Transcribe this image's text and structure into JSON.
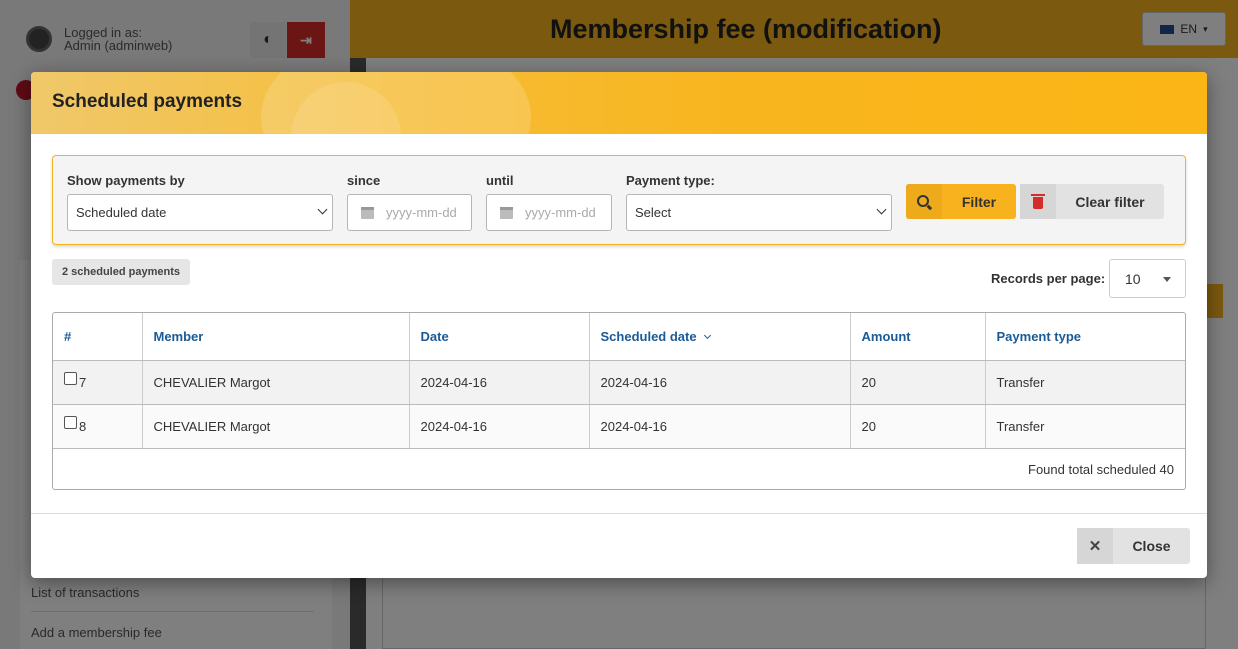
{
  "background": {
    "user": {
      "logged_in_label": "Logged in as:",
      "user_name": "Admin (adminweb)"
    },
    "page_title": "Membership fee (modification)",
    "language": "EN",
    "menu": [
      "List of transactions",
      "Add a membership fee"
    ]
  },
  "modal": {
    "title": "Scheduled payments",
    "filter": {
      "show_by_label": "Show payments by",
      "show_by_value": "Scheduled date",
      "since_label": "since",
      "since_placeholder": "yyyy-mm-dd",
      "until_label": "until",
      "until_placeholder": "yyyy-mm-dd",
      "payment_type_label": "Payment type:",
      "payment_type_value": "Select",
      "filter_button": "Filter",
      "clear_button": "Clear filter"
    },
    "count_badge": "2 scheduled payments",
    "records_per_page_label": "Records per page:",
    "records_per_page_value": "10",
    "table": {
      "columns": [
        "#",
        "Member",
        "Date",
        "Scheduled date",
        "Amount",
        "Payment type"
      ],
      "rows": [
        {
          "id": "7",
          "member": "CHEVALIER Margot",
          "date": "2024-04-16",
          "scheduled_date": "2024-04-16",
          "amount": "20",
          "payment_type": "Transfer"
        },
        {
          "id": "8",
          "member": "CHEVALIER Margot",
          "date": "2024-04-16",
          "scheduled_date": "2024-04-16",
          "amount": "20",
          "payment_type": "Transfer"
        }
      ],
      "footer": "Found total scheduled 40"
    },
    "close_button": "Close"
  },
  "colors": {
    "accent": "#f7b21d",
    "link": "#1a5b96",
    "danger": "#d62b2b"
  }
}
